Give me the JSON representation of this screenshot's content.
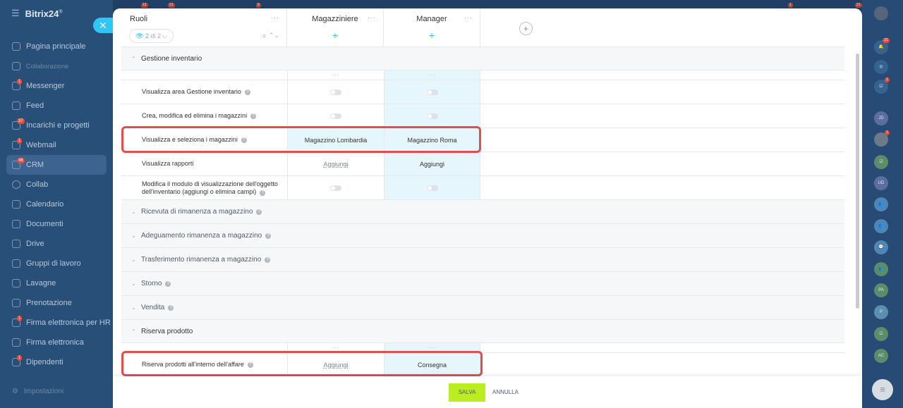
{
  "app": {
    "brand": "Bitrix24",
    "brand_sup": "®"
  },
  "sidebar": {
    "items": [
      {
        "label": "Pagina principale"
      },
      {
        "label": "Collaborazione",
        "small": true
      },
      {
        "label": "Messenger",
        "badge": "1"
      },
      {
        "label": "Feed"
      },
      {
        "label": "Incarichi e progetti",
        "badge": "37"
      },
      {
        "label": "Webmail",
        "badge": "1"
      },
      {
        "label": "CRM",
        "badge": "48",
        "active": true
      },
      {
        "label": "Collab"
      },
      {
        "label": "Calendario"
      },
      {
        "label": "Documenti"
      },
      {
        "label": "Drive"
      },
      {
        "label": "Gruppi di lavoro"
      },
      {
        "label": "Lavagne"
      },
      {
        "label": "Prenotazione"
      },
      {
        "label": "Firma elettronica per HR",
        "badge": "1"
      },
      {
        "label": "Firma elettronica"
      },
      {
        "label": "Dipendenti",
        "badge": "1"
      }
    ],
    "settings": "Impostazioni"
  },
  "rightbar": {
    "badges": {
      "notifications": "21",
      "tasks": "1",
      "avatar2": "1"
    },
    "avatars": [
      "JD",
      "UD",
      "PA",
      "P",
      "AC"
    ]
  },
  "topstrip": {
    "badges": [
      "12",
      "21",
      "5",
      "1",
      "21"
    ]
  },
  "table": {
    "roles_title": "Ruoli",
    "pager": {
      "current": "2",
      "of": "di 2"
    },
    "columns": [
      "Magazziniere",
      "Manager"
    ],
    "sections": {
      "inventory": "Gestione inventario",
      "receipt": "Ricevuta di rimanenza a magazzino",
      "adjustment": "Adeguamento rimanenza a magazzino",
      "transfer": "Trasferimento rimanenza a magazzino",
      "reversal": "Storno",
      "sale": "Vendita",
      "reserve": "Riserva prodotto"
    },
    "rows": {
      "view_area": "Visualizza area Gestione inventario",
      "edit_warehouses": "Crea, modifica ed elimina i magazzini",
      "view_select": "Visualizza e seleziona i magazzini",
      "view_reports": "Visualizza rapporti",
      "edit_form": "Modifica il modulo di visualizzazione dell'oggetto dell'inventario (aggiungi o elimina campi)",
      "reserve_in_deal": "Riserva prodotti all'interno dell'affare"
    },
    "values": {
      "view_select_c1": "Magazzino Lombardia",
      "view_select_c2": "Magazzino Roma",
      "reports_c1": "Aggiungi",
      "reports_c2": "Aggiungi",
      "reserve_c1": "Aggiungi",
      "reserve_c2": "Consegna"
    },
    "toggles": {
      "view_area": [
        false,
        false
      ],
      "edit_warehouses": [
        false,
        false
      ],
      "edit_form": [
        false,
        false
      ]
    }
  },
  "footer": {
    "save": "SALVA",
    "cancel": "ANNULLA"
  },
  "colors": {
    "accent": "#2fc6f6",
    "highlight_box": "#e54d4a",
    "save": "#bbed21",
    "selected_column": "#e6f6fd"
  }
}
